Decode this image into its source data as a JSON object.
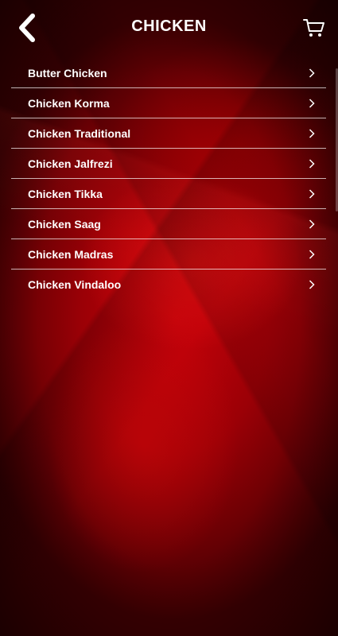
{
  "header": {
    "title": "CHICKEN",
    "back_icon": "chevron-left-icon",
    "cart_icon": "cart-icon"
  },
  "menu": {
    "items": [
      {
        "label": "Butter Chicken"
      },
      {
        "label": "Chicken Korma"
      },
      {
        "label": "Chicken Traditional"
      },
      {
        "label": "Chicken Jalfrezi"
      },
      {
        "label": "Chicken Tikka"
      },
      {
        "label": "Chicken Saag"
      },
      {
        "label": "Chicken Madras"
      },
      {
        "label": "Chicken Vindaloo"
      }
    ],
    "item_icon": "chevron-right-icon"
  },
  "colors": {
    "background": "#9b0006",
    "text": "#ffffff",
    "divider": "#ffffff"
  }
}
